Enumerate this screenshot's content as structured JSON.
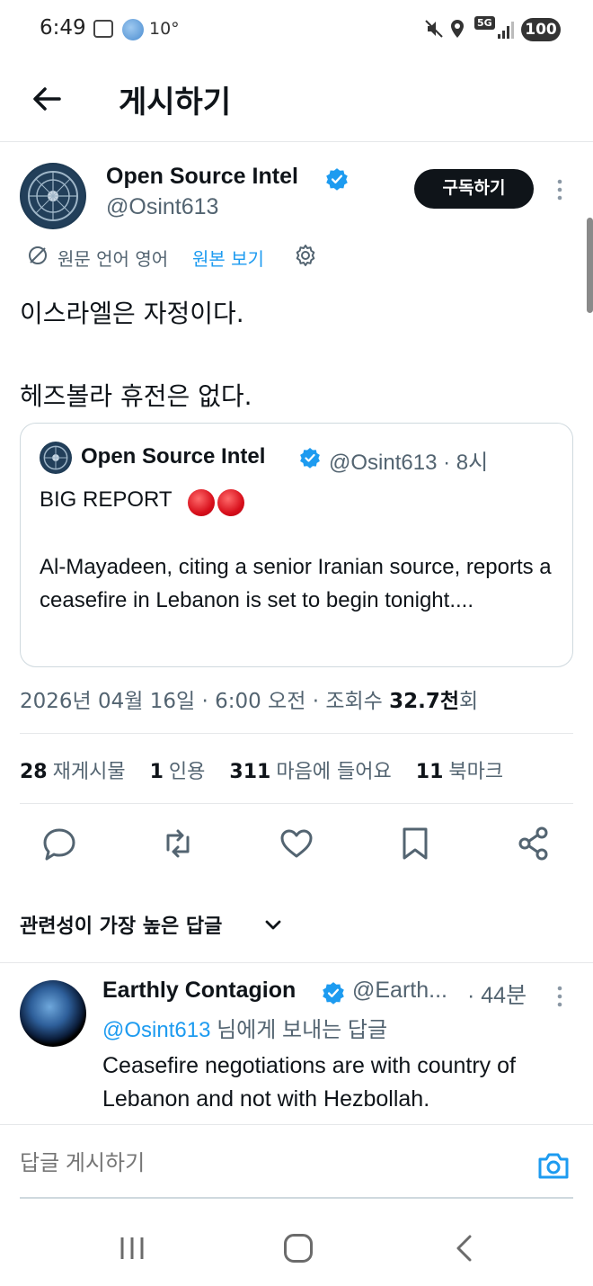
{
  "status_bar": {
    "time": "6:49",
    "temperature": "10°",
    "network": "5G",
    "battery": "100"
  },
  "header": {
    "back_icon": "arrow-left-icon",
    "title": "게시하기"
  },
  "post": {
    "author_name": "Open Source Intel",
    "author_handle": "@Osint613",
    "subscribe_label": "구독하기",
    "translate_info": "원문 언어 영어",
    "translate_link": "원본 보기",
    "text": "이스라엘은 자정이다.\n\n헤즈볼라 휴전은 없다.",
    "quote": {
      "author_name": "Open Source Intel",
      "author_handle": "@Osint613 · 8시",
      "headline": "BIG REPORT",
      "body": "Al-Mayadeen, citing a senior Iranian source, reports a ceasefire in Lebanon is set to begin tonight...."
    },
    "meta": {
      "datetime": "2026년 04월 16일 · 6:00 오전 · 조회수 ",
      "views": "32.7천",
      "views_suffix": "회"
    },
    "stats": [
      {
        "count": "28",
        "label": "재게시물"
      },
      {
        "count": "1",
        "label": "인용"
      },
      {
        "count": "311",
        "label": "마음에 들어요"
      },
      {
        "count": "11",
        "label": "북마크"
      }
    ],
    "accent_color": "#1d9bf0"
  },
  "replies_sort": "관련성이 가장 높은 답글",
  "reply": {
    "author_name": "Earthly Contagion",
    "author_handle": "@Earth...",
    "time": "· 44분",
    "reply_to_mention": "@Osint613",
    "reply_to_suffix": " 님에게 보내는 답글",
    "text": "Ceasefire negotiations are with country of Lebanon and not with Hezbollah."
  },
  "compose": {
    "placeholder": "답글 게시하기"
  }
}
